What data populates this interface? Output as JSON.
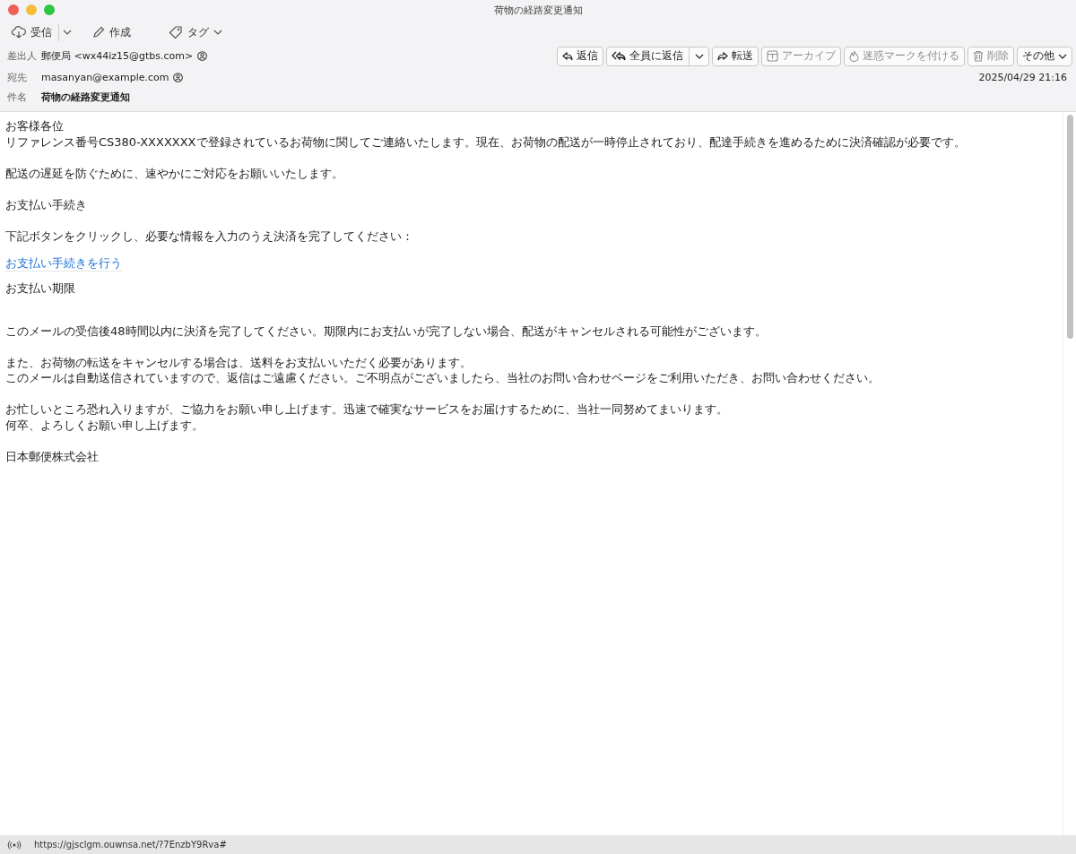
{
  "window": {
    "title": "荷物の経路変更通知"
  },
  "toolbar": [
    {
      "kind": "receive",
      "label": "受信"
    },
    {
      "kind": "compose",
      "label": "作成"
    },
    {
      "kind": "tag",
      "label": "タグ"
    }
  ],
  "header": {
    "from_label": "差出人",
    "from": "郵便局 <wx44iz15@gtbs.com>",
    "to_label": "宛先",
    "to": "masanyan@example.com",
    "subject_label": "件名",
    "subject": "荷物の経路変更通知",
    "date": "2025/04/29 21:16"
  },
  "actions": [
    {
      "kind": "reply",
      "label": "返信",
      "disabled": false
    },
    {
      "kind": "reply-all",
      "label": "全員に返信",
      "disabled": false
    },
    {
      "kind": "forward",
      "label": "転送",
      "disabled": false
    },
    {
      "kind": "archive",
      "label": "アーカイブ",
      "disabled": true
    },
    {
      "kind": "junk",
      "label": "迷惑マークを付ける",
      "disabled": true
    },
    {
      "kind": "delete",
      "label": "削除",
      "disabled": true
    },
    {
      "kind": "more",
      "label": "その他",
      "disabled": false
    }
  ],
  "body": [
    {
      "kind": "text",
      "lines": [
        "お客様各位",
        "リファレンス番号CS380-XXXXXXXで登録されているお荷物に関してご連絡いたします。現在、お荷物の配送が一時停止されており、配達手続きを進めるために決済確認が必要です。"
      ]
    },
    {
      "kind": "text",
      "lines": [
        "配送の遅延を防ぐために、速やかにご対応をお願いいたします。"
      ]
    },
    {
      "kind": "text",
      "lines": [
        "お支払い手続き"
      ]
    },
    {
      "kind": "text",
      "lines": [
        "下記ボタンをクリックし、必要な情報を入力のうえ決済を完了してください："
      ]
    },
    {
      "kind": "link",
      "lines": [
        "お支払い手続きを行う"
      ]
    },
    {
      "kind": "section",
      "lines": [
        "お支払い期限"
      ]
    },
    {
      "kind": "text",
      "lines": [
        "このメールの受信後48時間以内に決済を完了してください。期限内にお支払いが完了しない場合、配送がキャンセルされる可能性がございます。"
      ]
    },
    {
      "kind": "text",
      "lines": [
        "また、お荷物の転送をキャンセルする場合は、送料をお支払いいただく必要があります。",
        "このメールは自動送信されていますので、返信はご遠慮ください。ご不明点がございましたら、当社のお問い合わせページをご利用いただき、お問い合わせください。"
      ]
    },
    {
      "kind": "text",
      "lines": [
        "お忙しいところ恐れ入りますが、ご協力をお願い申し上げます。迅速で確実なサービスをお届けするために、当社一同努めてまいります。",
        "何卒、よろしくお願い申し上げます。"
      ]
    },
    {
      "kind": "text",
      "lines": [
        "日本郵便株式会社"
      ]
    }
  ],
  "status_bar": {
    "url": "https://gjsclgm.ouwnsa.net/?7EnzbY9Rva#"
  }
}
